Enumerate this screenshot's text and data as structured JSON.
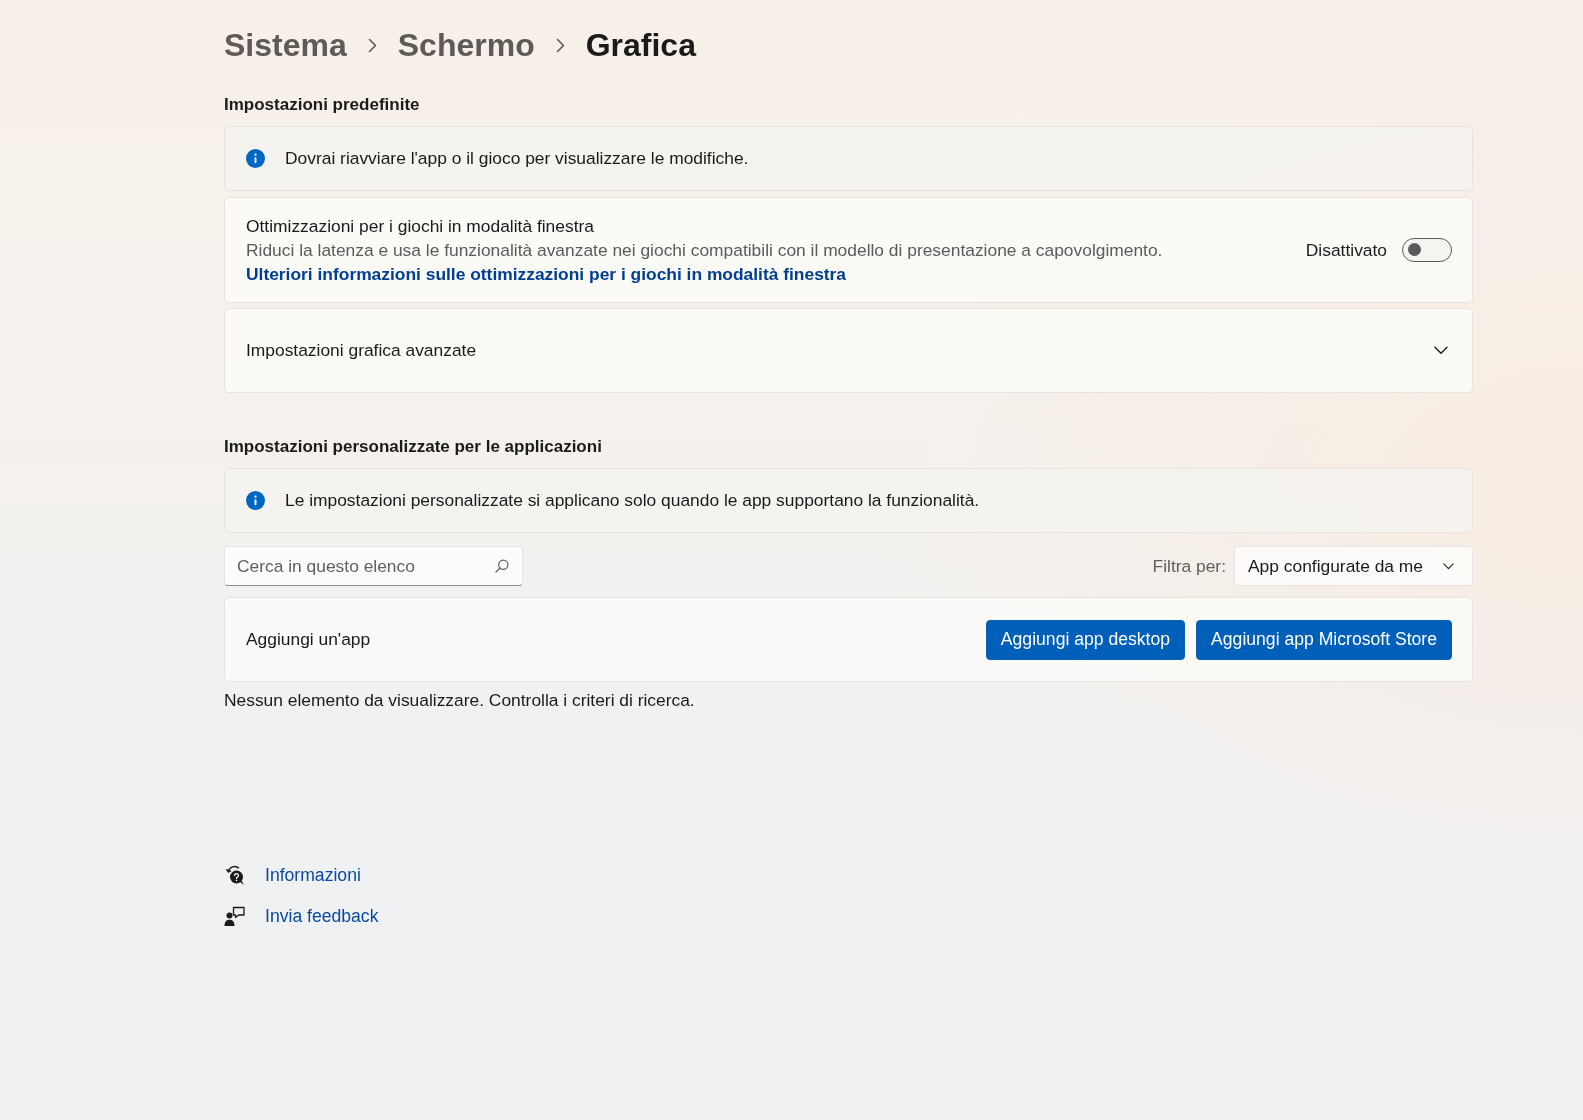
{
  "breadcrumb": [
    {
      "label": "Sistema",
      "current": false
    },
    {
      "label": "Schermo",
      "current": false
    },
    {
      "label": "Grafica",
      "current": true
    }
  ],
  "default_settings": {
    "heading": "Impostazioni predefinite",
    "info": "Dovrai riavviare l'app o il gioco per visualizzare le modifiche.",
    "windowed_optimizations": {
      "title": "Ottimizzazioni per i giochi in modalità finestra",
      "description": "Riduci la latenza e usa le funzionalità avanzate nei giochi compatibili con il modello di presentazione a capovolgimento.",
      "link": "Ulteriori informazioni sulle ottimizzazioni per i giochi in modalità finestra",
      "state_label": "Disattivato",
      "on": false
    },
    "advanced": {
      "label": "Impostazioni grafica avanzate",
      "expanded": false
    }
  },
  "app_settings": {
    "heading": "Impostazioni personalizzate per le applicazioni",
    "info": "Le impostazioni personalizzate si applicano solo quando le app supportano la funzionalità.",
    "search": {
      "placeholder": "Cerca in questo elenco"
    },
    "filter": {
      "label": "Filtra per:",
      "value": "App configurate da me"
    },
    "add_app": {
      "label": "Aggiungi un'app",
      "buttons": [
        "Aggiungi app desktop",
        "Aggiungi app Microsoft Store"
      ]
    },
    "empty_message": "Nessun elemento da visualizzare. Controlla i criteri di ricerca."
  },
  "footer_links": [
    {
      "kind": "help",
      "label": "Informazioni"
    },
    {
      "kind": "feedback",
      "label": "Invia feedback"
    }
  ]
}
